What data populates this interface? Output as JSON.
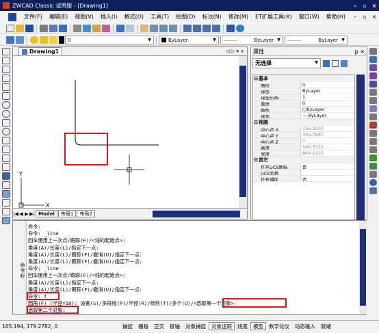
{
  "title": "ZWCAD Classic 试用版 - [Drawing1]",
  "menu": [
    "文件(F)",
    "编辑(E)",
    "视图(V)",
    "插入(I)",
    "格式(O)",
    "工具(T)",
    "绘图(D)",
    "标注(N)",
    "修改(M)",
    "ET扩展工具(X)",
    "窗口(W)",
    "帮助(H)"
  ],
  "toolbar2": {
    "layer_value": "0",
    "color": "ByLayer",
    "linetype": "ByLayer",
    "lineweight": "ByLayer"
  },
  "drawing_tab": "Drawing1",
  "layout_tabs": [
    "Model",
    "布局1",
    "布局2"
  ],
  "properties": {
    "header": "属性",
    "selection": "无选择",
    "categories": [
      {
        "name": "基本",
        "rows": [
          {
            "k": "图层",
            "v": "0"
          },
          {
            "k": "线型",
            "v": "ByLayer"
          },
          {
            "k": "线型比例",
            "v": "1"
          },
          {
            "k": "厚度",
            "v": "0"
          },
          {
            "k": "颜色",
            "v": "□ByLayer"
          },
          {
            "k": "线宽",
            "v": "— ByLayer"
          }
        ]
      },
      {
        "name": "视图",
        "rows": [
          {
            "k": "中心点 X",
            "v": "156.3303",
            "dim": true
          },
          {
            "k": "中心点 Y",
            "v": "305.7887",
            "dim": true
          },
          {
            "k": "中心点 Z",
            "v": "0",
            "dim": true
          },
          {
            "k": "高度",
            "v": "546.3322",
            "dim": true
          },
          {
            "k": "宽度",
            "v": "864.1215",
            "dim": true
          }
        ]
      },
      {
        "name": "其它",
        "rows": [
          {
            "k": "打开UCS图标",
            "v": "是"
          },
          {
            "k": "UCS名称",
            "v": ""
          },
          {
            "k": "打开捕捉",
            "v": "否"
          }
        ]
      }
    ]
  },
  "command_side_label": "命令栏",
  "command_lines": [
    "命令:",
    "命令: _line",
    "回车使用上一次点/跟踪(F)/<线的起始点>:",
    "角度(A)/长度(L)/指定下一点:",
    "角度(A)/长度(L)/跟踪(F)/撤消(U)/指定下一点:",
    "角度(A)/长度(L)/跟踪(F)/撤消(U)/指定下一点:",
    "命令: _line",
    "回车使用上一次点/跟踪(F)/<线的起始点>:",
    "角度(A)/长度(L)/指定下一点:",
    "角度(A)/长度(L)/跟踪(F)/撤消(U)/指定下一点:",
    "命令: f",
    "圆角(F) (半径=10): 设置(S)/多段线(P)/半径(R)/修剪(T)/多个(U)/<选取第一个对象>:",
    "选取第二个对象:"
  ],
  "status": {
    "coords": "165.194, 179.2782, 0",
    "buttons": [
      "捕捉",
      "栅格",
      "正交",
      "极轴",
      "对象捕捉",
      "对象追踪",
      "线宽",
      "模型",
      "数字化仪",
      "动态输入",
      "就绪"
    ],
    "active": [
      "对象追踪",
      "模型"
    ]
  }
}
